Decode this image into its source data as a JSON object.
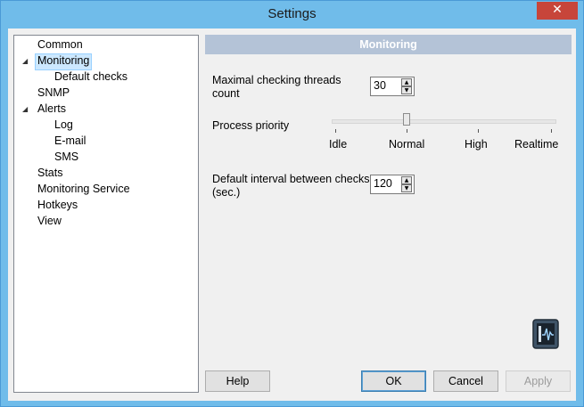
{
  "window": {
    "title": "Settings",
    "close_glyph": "✕"
  },
  "tree": {
    "items": [
      {
        "label": "Common"
      },
      {
        "label": "Monitoring"
      },
      {
        "label": "Default checks"
      },
      {
        "label": "SNMP"
      },
      {
        "label": "Alerts"
      },
      {
        "label": "Log"
      },
      {
        "label": "E-mail"
      },
      {
        "label": "SMS"
      },
      {
        "label": "Stats"
      },
      {
        "label": "Monitoring Service"
      },
      {
        "label": "Hotkeys"
      },
      {
        "label": "View"
      }
    ],
    "selected": "Monitoring"
  },
  "panel": {
    "header": "Monitoring",
    "threads": {
      "label_line1": "Maximal checking threads",
      "label_line2": "count",
      "value": "30"
    },
    "priority": {
      "label": "Process priority",
      "ticks": [
        "Idle",
        "Normal",
        "High",
        "Realtime"
      ],
      "selected": "Normal"
    },
    "interval": {
      "label_line1": "Default interval between checks",
      "label_line2": "(sec.)",
      "value": "120"
    }
  },
  "buttons": {
    "help": "Help",
    "ok": "OK",
    "cancel": "Cancel",
    "apply": "Apply"
  },
  "icons": {
    "spin_up": "▲",
    "spin_down": "▼",
    "expanded": "◢"
  },
  "colors": {
    "header_bg": "#b4c3d7",
    "selection_bg": "#cce8ff",
    "title_bg": "#70bcea",
    "close_bg": "#c7453a"
  }
}
